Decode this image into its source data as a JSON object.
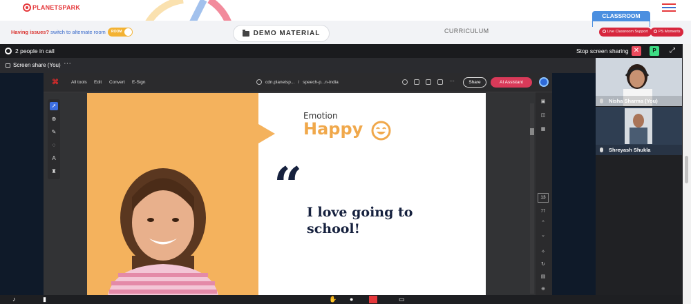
{
  "app": {
    "brand": "PLANETSPARK",
    "issue_question": "Having issues?",
    "issue_switch": "switch to alternate room",
    "toggle_label": "ROOM",
    "demo_material": "DEMO MATERIAL",
    "curriculum": "CURRICULUM",
    "classroom_tab": "CLASSROOM",
    "live_support": "Live Classroom Support",
    "ps_moments": "PS Moments",
    "accent": "#e5383b",
    "blue": "#4b8fe0"
  },
  "meeting": {
    "people_in_call": "2 people in call",
    "stop_sharing": "Stop screen sharing",
    "share_tab": "Screen share (You)",
    "share_tab_menu": "···",
    "p_button": "P"
  },
  "pdf": {
    "menu": [
      "All tools",
      "Edit",
      "Convert",
      "E-Sign"
    ],
    "url_host": "cdn.planetsp...",
    "url_sep": "/",
    "url_file": "speech-p...n-india",
    "share_label": "Share",
    "ai_label": "AI Assistant",
    "page_current": "13",
    "page_total": "77"
  },
  "slide": {
    "emotion_label": "Emotion",
    "emotion_value": "Happy",
    "quote_mark": "“",
    "quote": "I love going to school!"
  },
  "participants": [
    {
      "name": "Nisha Sharma (You)",
      "muted": false
    },
    {
      "name": "Shreyash Shukla",
      "muted": false
    }
  ],
  "icons": {
    "settings": "gear-icon",
    "close": "close-icon",
    "fullscreen": "fullscreen-icon",
    "menu": "hamburger-icon",
    "folder": "folder-icon"
  }
}
